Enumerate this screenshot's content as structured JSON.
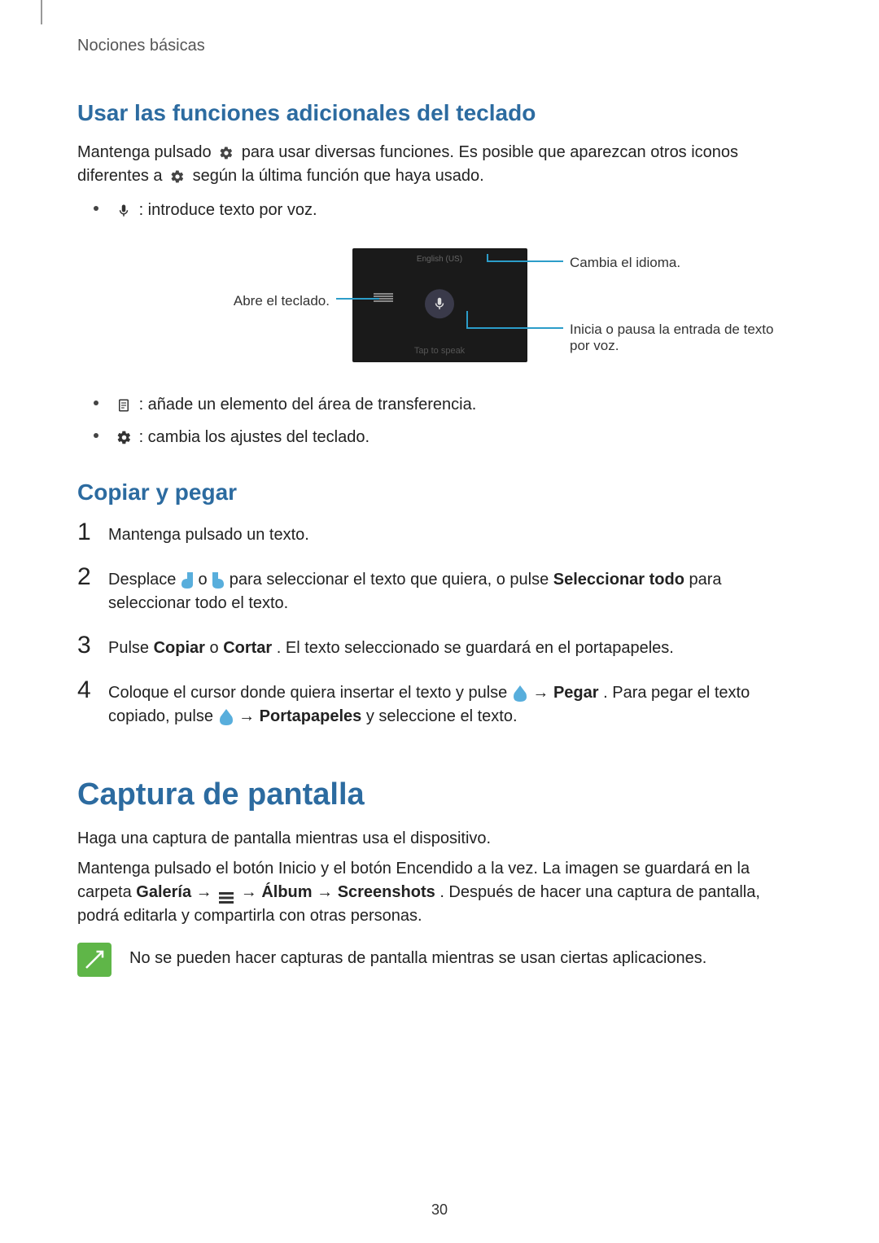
{
  "breadcrumb": "Nociones básicas",
  "section1": {
    "heading": "Usar las funciones adicionales del teclado",
    "intro_a": "Mantenga pulsado ",
    "intro_b": " para usar diversas funciones. Es posible que aparezcan otros iconos diferentes a ",
    "intro_c": " según la última función que haya usado.",
    "bullet_voice": " : introduce texto por voz.",
    "bullet_clipboard": " : añade un elemento del área de transferencia.",
    "bullet_settings": " : cambia los ajustes del teclado."
  },
  "diagram": {
    "panel_top": "English (US)",
    "panel_bottom": "Tap to speak",
    "label_left": "Abre el teclado.",
    "label_right_top": "Cambia el idioma.",
    "label_right_bot": "Inicia o pausa la entrada de texto por voz."
  },
  "section2": {
    "heading": "Copiar y pegar",
    "step1": "Mantenga pulsado un texto.",
    "step2_a": "Desplace ",
    "step2_b": " o ",
    "step2_c": " para seleccionar el texto que quiera, o pulse ",
    "step2_bold": "Seleccionar todo",
    "step2_d": " para seleccionar todo el texto.",
    "step3_a": "Pulse ",
    "step3_b1": "Copiar",
    "step3_mid": " o ",
    "step3_b2": "Cortar",
    "step3_c": ". El texto seleccionado se guardará en el portapapeles.",
    "step4_a": "Coloque el cursor donde quiera insertar el texto y pulse ",
    "step4_arrow1": " → ",
    "step4_b1": "Pegar",
    "step4_c": ". Para pegar el texto copiado, pulse ",
    "step4_arrow2": " → ",
    "step4_b2": "Portapapeles",
    "step4_d": " y seleccione el texto."
  },
  "section3": {
    "heading": "Captura de pantalla",
    "p1": "Haga una captura de pantalla mientras usa el dispositivo.",
    "p2_a": "Mantenga pulsado el botón Inicio y el botón Encendido a la vez. La imagen se guardará en la carpeta ",
    "p2_b1": "Galería",
    "p2_arr1": " → ",
    "p2_arr2": " → ",
    "p2_b2": "Álbum",
    "p2_arr3": " → ",
    "p2_b3": "Screenshots",
    "p2_c": ". Después de hacer una captura de pantalla, podrá editarla y compartirla con otras personas.",
    "note": "No se pueden hacer capturas de pantalla mientras se usan ciertas aplicaciones."
  },
  "page_number": "30"
}
